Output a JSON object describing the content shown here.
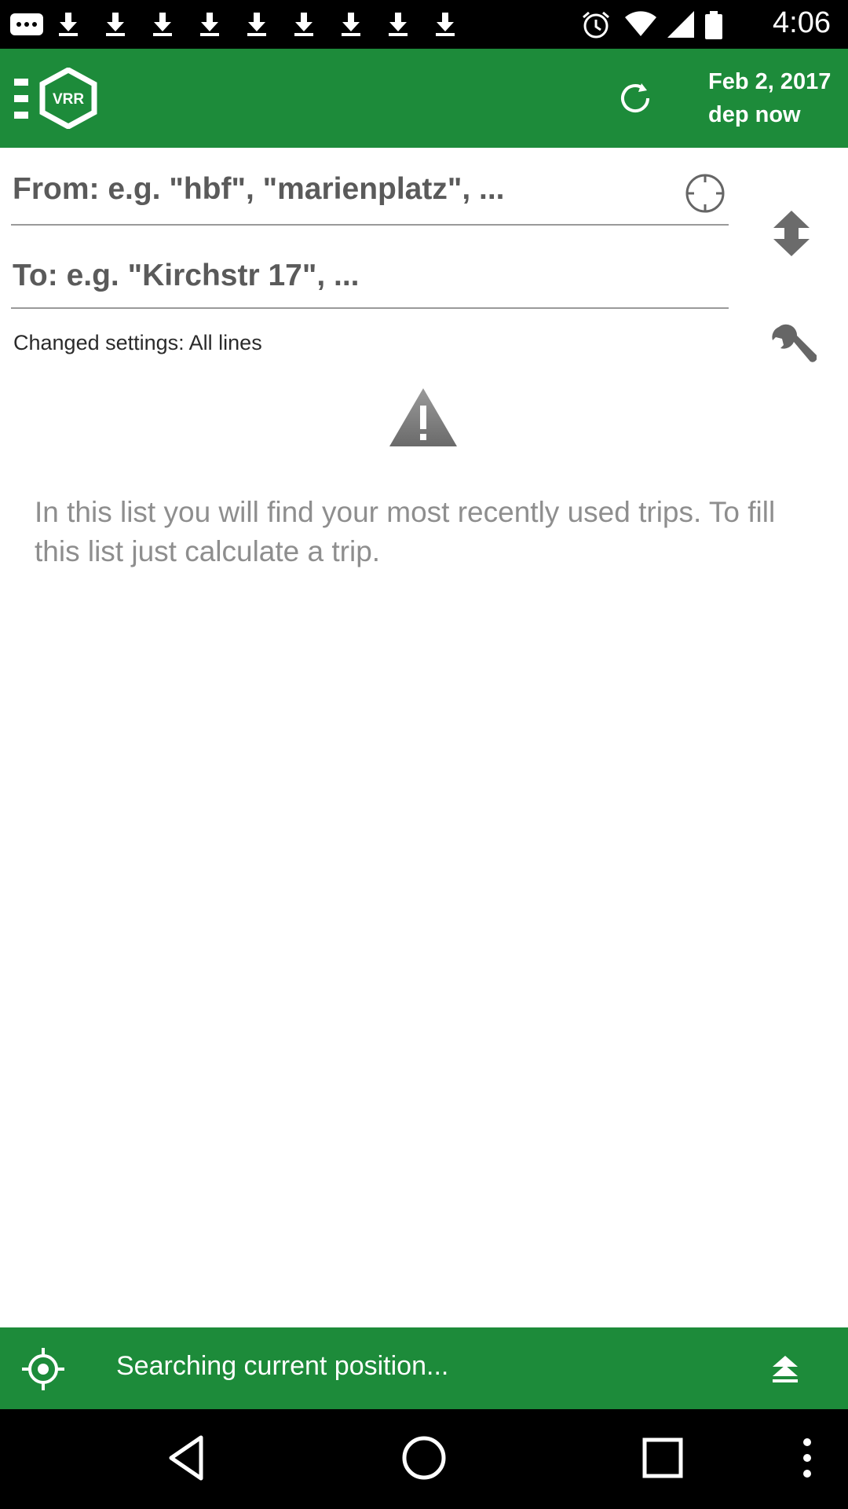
{
  "status_bar": {
    "time": "4:06",
    "notification_icons": [
      "messages-icon",
      "download-icon",
      "download-icon",
      "download-icon",
      "download-icon",
      "download-icon",
      "download-icon",
      "download-icon",
      "download-icon",
      "download-icon"
    ],
    "system_icons": [
      "alarm-icon",
      "wifi-icon",
      "signal-icon",
      "battery-icon"
    ]
  },
  "app_bar": {
    "logo_text": "VRR",
    "date": "Feb 2, 2017",
    "departure": "dep now"
  },
  "form": {
    "from_placeholder": "From: e.g. \"hbf\", \"marienplatz\", ...",
    "from_value": "",
    "to_placeholder": "To: e.g. \"Kirchstr 17\", ...",
    "to_value": "",
    "settings_text": "Changed settings: All lines"
  },
  "empty_state": {
    "message": "In this list you will find your most recently used trips. To fill this list just calculate a trip."
  },
  "bottom_bar": {
    "status": "Searching current position..."
  },
  "colors": {
    "primary": "#1d8b3a",
    "hint_text": "#8e8e8e"
  }
}
